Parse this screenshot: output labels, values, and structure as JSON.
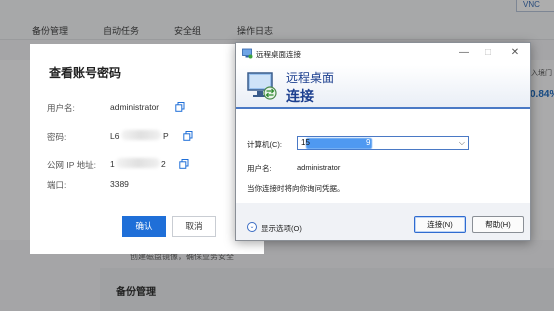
{
  "background": {
    "nav_items": [
      "备份管理",
      "自动任务",
      "安全组",
      "操作日志"
    ],
    "vnc_button": "VNC",
    "right_text_1": "入境门",
    "right_percent": "0.84%",
    "bottom_hint": "创建磁盘镜像，确保业务安全",
    "section_title": "备份管理"
  },
  "account_dialog": {
    "title": "查看账号密码",
    "fields": [
      {
        "label": "用户名:",
        "value": "administrator"
      },
      {
        "label": "密码:",
        "value_start": "L6",
        "value_end": "P"
      },
      {
        "label": "公网 IP 地址:",
        "value_start": "1",
        "value_end": "2"
      },
      {
        "label": "端口:",
        "value": "3389"
      }
    ],
    "confirm_label": "确认",
    "cancel_label": "取消"
  },
  "rdp_window": {
    "title": "远程桌面连接",
    "header_line1": "远程桌面",
    "header_line2": "连接",
    "computer_label": "计算机(C):",
    "computer_value_start": "15",
    "computer_value_end": "9",
    "username_label": "用户名:",
    "username_value": "administrator",
    "credential_note": "当你连接时将向你询问凭据。",
    "show_options": "显示选项(O)",
    "connect_button": "连接(N)",
    "help_button": "帮助(H)"
  },
  "colors": {
    "primary_blue": "#1f6fd8",
    "rdp_accent": "#4a79c5",
    "rdp_header_text": "#1c3f8f"
  }
}
